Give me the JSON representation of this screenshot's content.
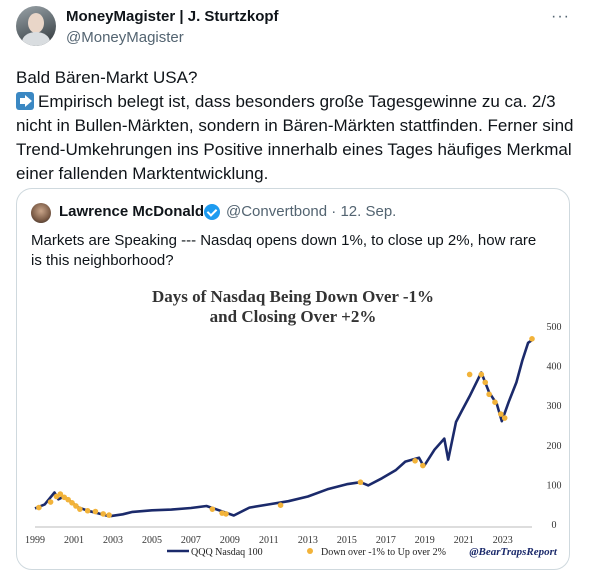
{
  "author": {
    "name": "MoneyMagister | J. Sturtzkopf",
    "handle": "@MoneyMagister"
  },
  "more_label": "···",
  "tweet": {
    "line1": "Bald Bären-Markt USA?",
    "line2": "Empirisch belegt ist, dass besonders große Tagesgewinne zu ca. 2/3 nicht in Bullen-Märkten, sondern in Bären-Märkten stattfinden. Ferner sind Trend-Umkehrungen ins Positive innerhalb eines Tages häufiges Merkmal einer fallenden Marktentwicklung.",
    "icon": "right-arrow-icon"
  },
  "quote": {
    "name": "Lawrence McDonald",
    "handle": "@Convertbond · 12. Sep.",
    "text": "Markets are Speaking --- Nasdaq opens down 1%, to close up 2%, how rare is this neighborhood?"
  },
  "chart_data": {
    "type": "line",
    "title_line1": "Days of Nasdaq Being Down Over -1%",
    "title_line2": "and Closing Over +2%",
    "x_ticks": [
      "1999",
      "2001",
      "2003",
      "2005",
      "2007",
      "2009",
      "2011",
      "2013",
      "2015",
      "2017",
      "2019",
      "2021",
      "2023"
    ],
    "y_ticks": [
      "0",
      "100",
      "200",
      "300",
      "400",
      "500"
    ],
    "xlim": [
      1999,
      2024.5
    ],
    "ylim": [
      0,
      520
    ],
    "series": [
      {
        "name": "QQQ Nasdaq 100",
        "color": "#1b2a6b",
        "x": [
          1999,
          1999.5,
          2000,
          2000.2,
          2000.5,
          2000.8,
          2001.2,
          2001.7,
          2002.2,
          2002.8,
          2003.5,
          2004,
          2005,
          2006,
          2007,
          2007.8,
          2008.5,
          2009.2,
          2010,
          2011,
          2012,
          2013,
          2014,
          2015,
          2015.7,
          2016.1,
          2016.8,
          2017.5,
          2018,
          2018.7,
          2018.95,
          2019.5,
          2020,
          2020.2,
          2020.6,
          2020.9,
          2021.3,
          2021.9,
          2022.3,
          2022.7,
          2022.95,
          2023.3,
          2023.7,
          2024,
          2024.3,
          2024.6
        ],
        "y": [
          42,
          52,
          82,
          65,
          72,
          60,
          45,
          36,
          30,
          22,
          27,
          33,
          37,
          39,
          43,
          48,
          36,
          24,
          44,
          52,
          60,
          72,
          90,
          103,
          108,
          100,
          118,
          138,
          160,
          170,
          148,
          190,
          218,
          165,
          260,
          288,
          325,
          385,
          335,
          305,
          262,
          310,
          360,
          415,
          460,
          470
        ]
      },
      {
        "name": "Down over -1% to Up over 2%",
        "color": "#f2b33a",
        "x": [
          1999.2,
          1999.8,
          2000.1,
          2000.3,
          2000.5,
          2000.7,
          2000.9,
          2001.1,
          2001.3,
          2001.7,
          2002.1,
          2002.5,
          2002.8,
          2008.1,
          2008.6,
          2008.8,
          2011.6,
          2015.7,
          2018.5,
          2018.9,
          2021.3,
          2021.9,
          2022.1,
          2022.3,
          2022.6,
          2022.9,
          2023.1,
          2024.5
        ],
        "y": [
          44,
          58,
          72,
          78,
          70,
          64,
          56,
          48,
          40,
          36,
          34,
          28,
          25,
          40,
          30,
          28,
          50,
          108,
          162,
          150,
          380,
          380,
          360,
          330,
          310,
          280,
          270,
          470
        ]
      }
    ],
    "legend": [
      "QQQ Nasdaq 100",
      "Down over -1% to Up over 2%"
    ],
    "source": "@BearTrapsReport"
  }
}
